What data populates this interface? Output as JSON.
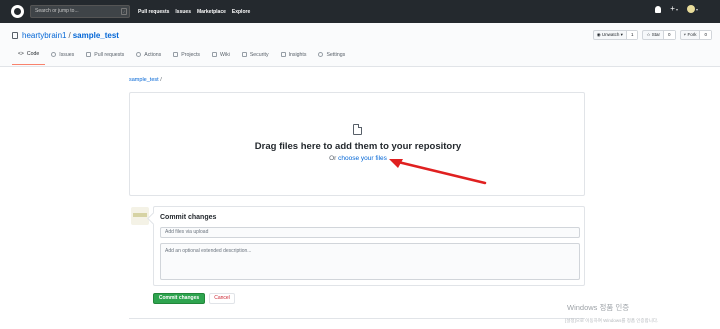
{
  "topbar": {
    "search_placeholder": "Search or jump to...",
    "search_key": "/",
    "nav": [
      "Pull requests",
      "Issues",
      "Marketplace",
      "Explore"
    ],
    "plus": "+",
    "caret": "▾"
  },
  "repo": {
    "owner": "heartybrain1",
    "separator": "/",
    "name": "sample_test",
    "actions": [
      {
        "label": "◉ Unwatch ▾",
        "count": "1"
      },
      {
        "label": "☆ Star",
        "count": "0"
      },
      {
        "label": "⑂ Fork",
        "count": "0"
      }
    ],
    "tabs": [
      {
        "label": "Code",
        "active": true
      },
      {
        "label": "Issues",
        "active": false
      },
      {
        "label": "Pull requests",
        "active": false
      },
      {
        "label": "Actions",
        "active": false
      },
      {
        "label": "Projects",
        "active": false
      },
      {
        "label": "Wiki",
        "active": false
      },
      {
        "label": "Security",
        "active": false
      },
      {
        "label": "Insights",
        "active": false
      },
      {
        "label": "Settings",
        "active": false
      }
    ]
  },
  "breadcrumb": {
    "repo": "sample_test",
    "sep": "/"
  },
  "upload": {
    "title": "Drag files here to add them to your repository",
    "or": "Or ",
    "choose": "choose your files"
  },
  "commit": {
    "title": "Commit changes",
    "summary_placeholder": "Add files via upload",
    "description_placeholder": "Add an optional extended description...",
    "commit_button": "Commit changes",
    "cancel_button": "Cancel"
  },
  "os": {
    "watermark": "Windows 정품 인증",
    "watermark_sub": "[설정]으로 이동하여 Windows를 정품 인증합니다."
  },
  "colors": {
    "accent": "#0366d6",
    "commit_green": "#2ea44f",
    "arrow_red": "#e02020"
  }
}
